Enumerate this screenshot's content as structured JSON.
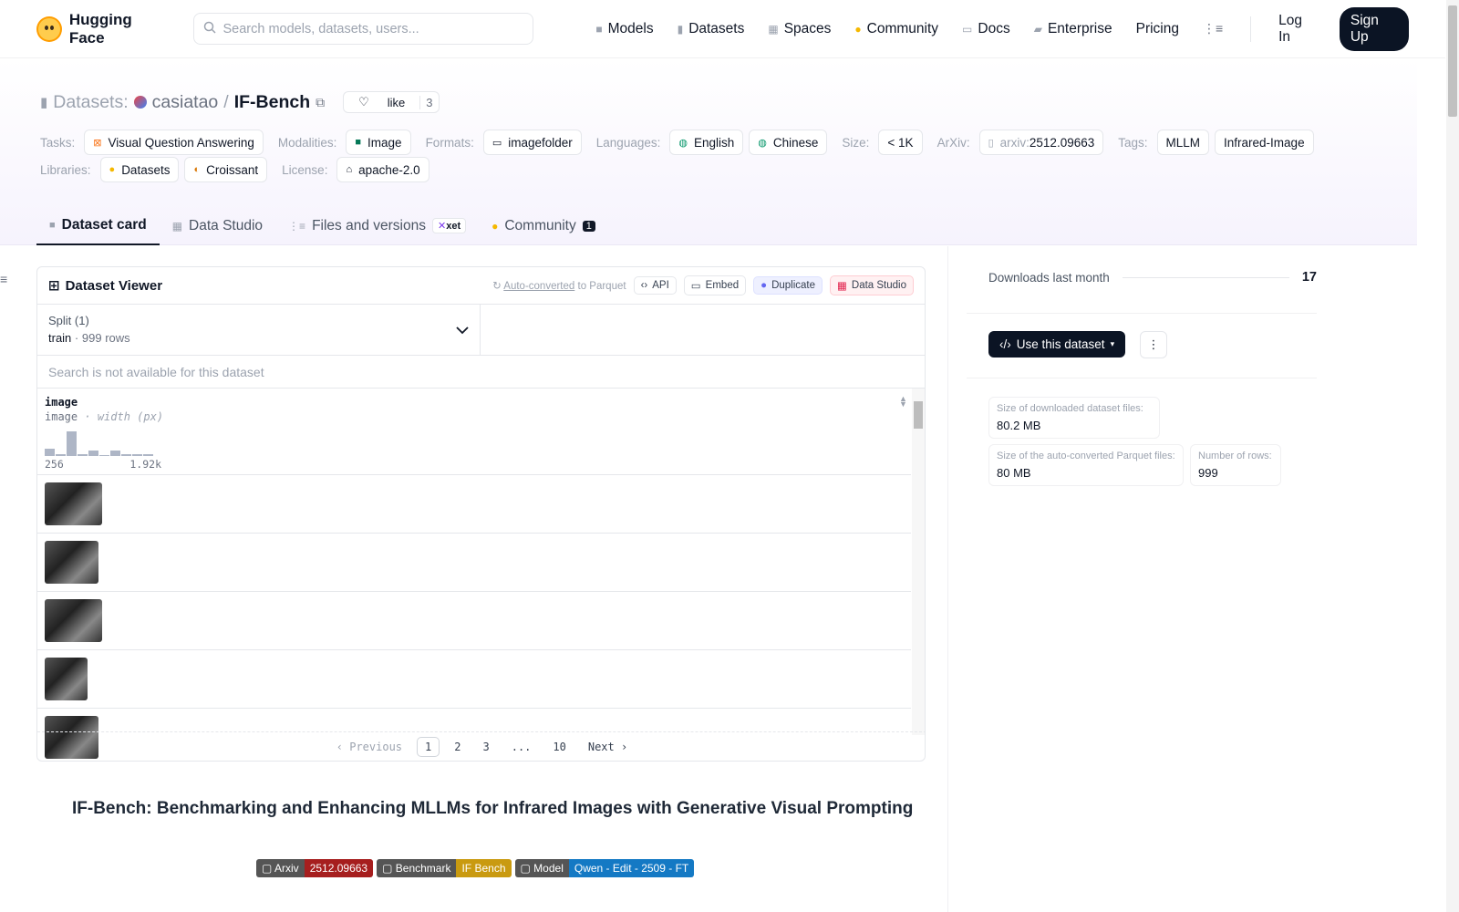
{
  "header": {
    "brand": "Hugging Face",
    "search_placeholder": "Search models, datasets, users...",
    "nav": [
      {
        "label": "Models",
        "icon": "cube-icon"
      },
      {
        "label": "Datasets",
        "icon": "database-icon"
      },
      {
        "label": "Spaces",
        "icon": "grid-icon"
      },
      {
        "label": "Community",
        "icon": "hands-icon"
      },
      {
        "label": "Docs",
        "icon": "book-icon"
      },
      {
        "label": "Enterprise",
        "icon": "enterprise-icon"
      },
      {
        "label": "Pricing",
        "icon": ""
      }
    ],
    "login": "Log In",
    "signup": "Sign Up"
  },
  "repo": {
    "type_label": "Datasets:",
    "owner": "casiatao",
    "slash": "/",
    "name": "IF-Bench",
    "like_label": "like",
    "like_count": "3",
    "tasks_label": "Tasks:",
    "task": "Visual Question Answering",
    "modalities_label": "Modalities:",
    "modality": "Image",
    "formats_label": "Formats:",
    "format": "imagefolder",
    "languages_label": "Languages:",
    "lang1": "English",
    "lang2": "Chinese",
    "size_label": "Size:",
    "size": "< 1K",
    "arxiv_label": "ArXiv:",
    "arxiv_prefix": "arxiv:",
    "arxiv_id": "2512.09663",
    "tags_label": "Tags:",
    "tag1": "MLLM",
    "tag2": "Infrared-Image",
    "libraries_label": "Libraries:",
    "lib1": "Datasets",
    "lib2": "Croissant",
    "license_label": "License:",
    "license": "apache-2.0"
  },
  "tabs": {
    "card": "Dataset card",
    "studio": "Data Studio",
    "files": "Files and versions",
    "xet": "xet",
    "community": "Community",
    "community_count": "1"
  },
  "viewer": {
    "title": "Dataset Viewer",
    "auto_converted": "Auto-converted",
    "to_parquet": "to Parquet",
    "api": "API",
    "embed": "Embed",
    "duplicate": "Duplicate",
    "data_studio": "Data Studio",
    "split_label": "Split (1)",
    "split_name": "train",
    "split_dot": "·",
    "split_rows": "999 rows",
    "search_na": "Search is not available for this dataset",
    "col_name": "image",
    "col_type": "image",
    "col_type_sep": "·",
    "col_subtype": "width (px)",
    "hist_min": "256",
    "hist_max": "1.92k",
    "histogram": [
      0.3,
      0.08,
      0.95,
      0.08,
      0.2,
      0.04,
      0.22,
      0.08,
      0.06,
      0.08
    ],
    "thumb_widths": [
      63,
      59,
      63,
      47,
      59
    ],
    "pager": {
      "prev": "Previous",
      "p1": "1",
      "p2": "2",
      "p3": "3",
      "ellipsis": "...",
      "p10": "10",
      "next": "Next"
    }
  },
  "readme": {
    "title": "IF-Bench: Benchmarking and Enhancing MLLMs for Infrared Images with Generative Visual Prompting",
    "badges": [
      {
        "left": "Arxiv",
        "right": "2512.09663",
        "color": "#a61e1e"
      },
      {
        "left": "Benchmark",
        "right": "IF Bench",
        "color": "#c99a10"
      },
      {
        "left": "Model",
        "right": "Qwen - Edit - 2509 - FT",
        "color": "#1479c4"
      }
    ]
  },
  "sidebar": {
    "downloads_label": "Downloads last month",
    "downloads": "17",
    "use_dataset": "Use this dataset",
    "size_dl_label": "Size of downloaded dataset files:",
    "size_dl": "80.2 MB",
    "size_parquet_label": "Size of the auto-converted Parquet files:",
    "size_parquet": "80 MB",
    "rows_label": "Number of rows:",
    "rows": "999"
  }
}
